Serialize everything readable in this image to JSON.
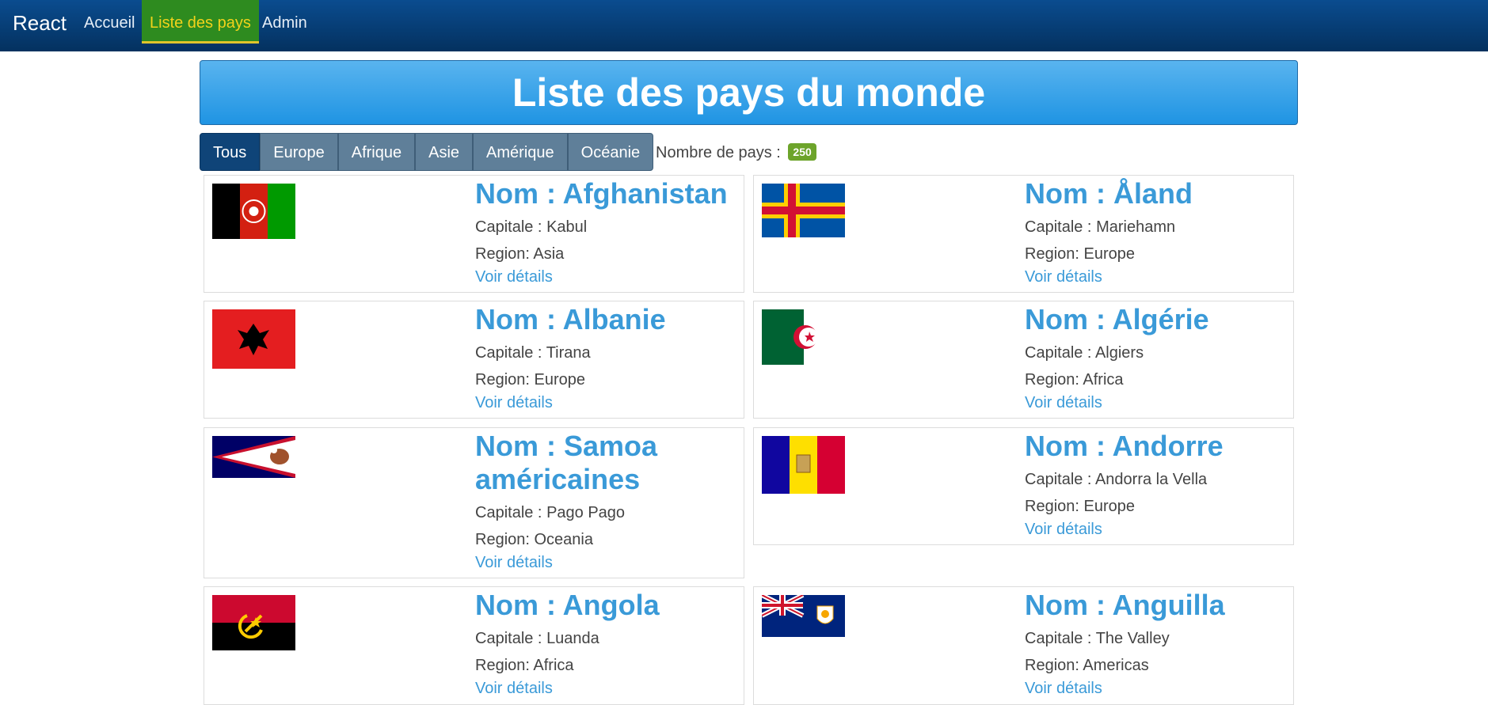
{
  "nav": {
    "brand": "React",
    "links": [
      "Accueil",
      "Liste des pays",
      "Admin"
    ]
  },
  "banner": {
    "title": "Liste des pays du monde"
  },
  "filters": {
    "buttons": [
      "Tous",
      "Europe",
      "Afrique",
      "Asie",
      "Amérique",
      "Océanie"
    ],
    "count_label": "Nombre de pays :",
    "count": "250"
  },
  "countries": [
    {
      "name_prefix": "Nom : ",
      "name": "Afghanistan",
      "capital_label": "Capitale : ",
      "capital": "Kabul",
      "region_label": "Region: ",
      "region": "Asia",
      "link": "Voir détails",
      "flag_icon": "afghanistan-flag-icon"
    },
    {
      "name_prefix": "Nom : ",
      "name": "Åland",
      "capital_label": "Capitale : ",
      "capital": "Mariehamn",
      "region_label": "Region: ",
      "region": "Europe",
      "link": "Voir détails",
      "flag_icon": "aland-flag-icon"
    },
    {
      "name_prefix": "Nom : ",
      "name": "Albanie",
      "capital_label": "Capitale : ",
      "capital": "Tirana",
      "region_label": "Region: ",
      "region": "Europe",
      "link": "Voir détails",
      "flag_icon": "albania-flag-icon"
    },
    {
      "name_prefix": "Nom : ",
      "name": "Algérie",
      "capital_label": "Capitale : ",
      "capital": "Algiers",
      "region_label": "Region: ",
      "region": "Africa",
      "link": "Voir détails",
      "flag_icon": "algeria-flag-icon"
    },
    {
      "name_prefix": "Nom : ",
      "name": "Samoa américaines",
      "capital_label": "Capitale : ",
      "capital": "Pago Pago",
      "region_label": "Region: ",
      "region": "Oceania",
      "link": "Voir détails",
      "flag_icon": "american-samoa-flag-icon"
    },
    {
      "name_prefix": "Nom : ",
      "name": "Andorre",
      "capital_label": "Capitale : ",
      "capital": "Andorra la Vella",
      "region_label": "Region: ",
      "region": "Europe",
      "link": "Voir détails",
      "flag_icon": "andorra-flag-icon"
    },
    {
      "name_prefix": "Nom : ",
      "name": "Angola",
      "capital_label": "Capitale : ",
      "capital": "Luanda",
      "region_label": "Region: ",
      "region": "Africa",
      "link": "Voir détails",
      "flag_icon": "angola-flag-icon"
    },
    {
      "name_prefix": "Nom : ",
      "name": "Anguilla",
      "capital_label": "Capitale : ",
      "capital": "The Valley",
      "region_label": "Region: ",
      "region": "Americas",
      "link": "Voir détails",
      "flag_icon": "anguilla-flag-icon"
    }
  ]
}
